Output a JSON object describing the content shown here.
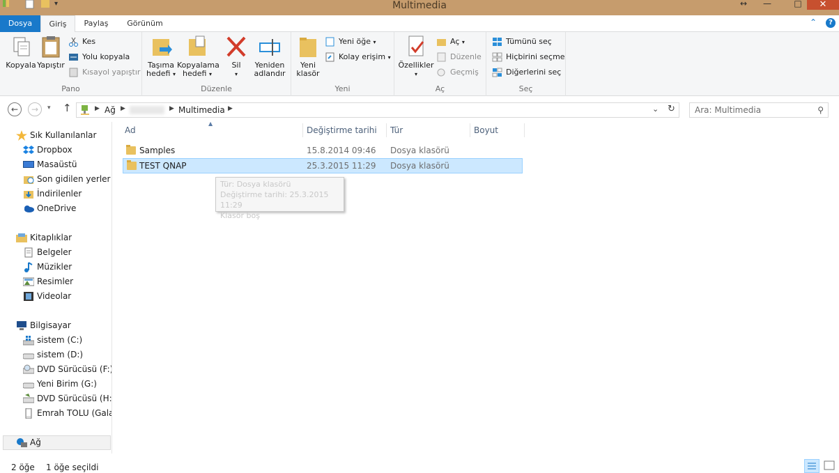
{
  "window": {
    "title": "Multimedia"
  },
  "ribbon_tabs": [
    {
      "label": "Dosya"
    },
    {
      "label": "Giriş"
    },
    {
      "label": "Paylaş"
    },
    {
      "label": "Görünüm"
    }
  ],
  "ribbon": {
    "pano": {
      "label": "Pano",
      "copy": "Kopyala",
      "paste": "Yapıştır",
      "cut": "Kes",
      "copy_path": "Yolu kopyala",
      "paste_shortcut": "Kısayol yapıştır"
    },
    "duzenle": {
      "label": "Düzenle",
      "move_to_1": "Taşıma",
      "move_to_2": "hedefi",
      "copy_to_1": "Kopyalama",
      "copy_to_2": "hedefi",
      "delete": "Sil",
      "rename_1": "Yeniden",
      "rename_2": "adlandır"
    },
    "yeni": {
      "label": "Yeni",
      "new_folder_1": "Yeni",
      "new_folder_2": "klasör",
      "new_item": "Yeni öğe",
      "easy_access": "Kolay erişim"
    },
    "ac": {
      "label": "Aç",
      "properties": "Özellikler",
      "open": "Aç",
      "edit": "Düzenle",
      "history": "Geçmiş"
    },
    "sec": {
      "label": "Seç",
      "select_all": "Tümünü seç",
      "select_none": "Hiçbirini seçme",
      "invert": "Diğerlerini seç"
    }
  },
  "address": {
    "crumbs": [
      "Ağ",
      "Multimedia"
    ],
    "search_placeholder": "Ara: Multimedia"
  },
  "nav": {
    "favorites": {
      "label": "Sık Kullanılanlar",
      "items": [
        "Dropbox",
        "Masaüstü",
        "Son gidilen yerler",
        "İndirilenler",
        "OneDrive"
      ]
    },
    "libraries": {
      "label": "Kitaplıklar",
      "items": [
        "Belgeler",
        "Müzikler",
        "Resimler",
        "Videolar"
      ]
    },
    "computer": {
      "label": "Bilgisayar",
      "items": [
        "sistem (C:)",
        "sistem (D:)",
        "DVD Sürücüsü (F:) G",
        "Yeni Birim (G:)",
        "DVD Sürücüsü (H:) II",
        "Emrah TOLU (Galaxy"
      ]
    },
    "network": {
      "label": "Ağ"
    }
  },
  "columns": [
    "Ad",
    "Değiştirme tarihi",
    "Tür",
    "Boyut"
  ],
  "files": [
    {
      "name": "Samples",
      "date": "15.8.2014 09:46",
      "type": "Dosya klasörü",
      "size": ""
    },
    {
      "name": "TEST QNAP",
      "date": "25.3.2015 11:29",
      "type": "Dosya klasörü",
      "size": ""
    }
  ],
  "tooltip": {
    "line1": "Tür: Dosya klasörü",
    "line2": "Değiştirme tarihi: 25.3.2015 11:29",
    "line3": "Klasör boş"
  },
  "status": {
    "count": "2 öğe",
    "selected": "1 öğe seçildi"
  }
}
